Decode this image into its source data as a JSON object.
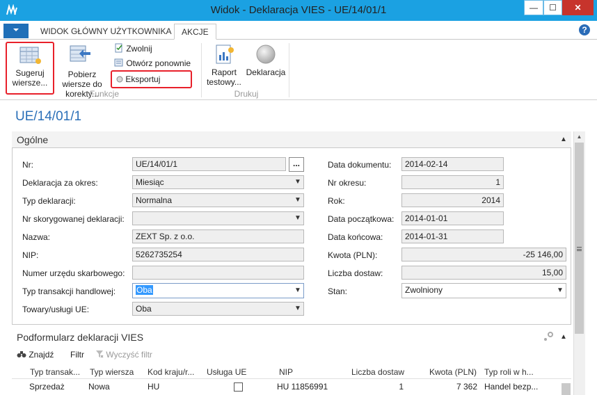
{
  "window": {
    "title": "Widok - Deklaracja VIES - UE/14/01/1",
    "help_label": "?",
    "minimize_label": "—",
    "maximize_label": "☐",
    "close_label": "✕"
  },
  "ribbon": {
    "tabs": [
      {
        "label": "WIDOK GŁÓWNY UŻYTKOWNIKA"
      },
      {
        "label": "AKCJE"
      }
    ],
    "buttons": {
      "suggest_lines": "Sugeruj wiersze...",
      "get_corrections": "Pobierz wiersze do korekty...",
      "release": "Zwolnij",
      "reopen": "Otwórz ponownie",
      "export": "Eksportuj",
      "test_report": "Raport testowy...",
      "declaration": "Deklaracja"
    },
    "groups": {
      "functions": "Funkcje",
      "print": "Drukuj"
    }
  },
  "document": {
    "title": "UE/14/01/1"
  },
  "general": {
    "title": "Ogólne",
    "left_fields": [
      {
        "label": "Nr:",
        "value": "UE/14/01/1"
      },
      {
        "label": "Deklaracja za okres:",
        "value": "Miesiąc"
      },
      {
        "label": "Typ deklaracji:",
        "value": "Normalna"
      },
      {
        "label": "Nr skorygowanej deklaracji:",
        "value": ""
      },
      {
        "label": "Nazwa:",
        "value": "ZEXT Sp. z o.o."
      },
      {
        "label": "NIP:",
        "value": "5262735254"
      },
      {
        "label": "Numer urzędu skarbowego:",
        "value": ""
      },
      {
        "label": "Typ transakcji handlowej:",
        "value": "Oba"
      },
      {
        "label": "Towary/usługi UE:",
        "value": "Oba"
      }
    ],
    "right_fields": [
      {
        "label": "Data dokumentu:",
        "value": "2014-02-14"
      },
      {
        "label": "Nr okresu:",
        "value": "1"
      },
      {
        "label": "Rok:",
        "value": "2014"
      },
      {
        "label": "Data początkowa:",
        "value": "2014-01-01"
      },
      {
        "label": "Data końcowa:",
        "value": "2014-01-31"
      },
      {
        "label": "Kwota (PLN):",
        "value": "-25 146,00"
      },
      {
        "label": "Liczba dostaw:",
        "value": "15,00"
      },
      {
        "label": "Stan:",
        "value": "Zwolniony"
      }
    ],
    "assist_button": "..."
  },
  "subform": {
    "title": "Podformularz deklaracji VIES",
    "toolbar": {
      "find": "Znajdź",
      "filter": "Filtr",
      "clear_filter": "Wyczyść filtr"
    },
    "columns": [
      "Typ transak...",
      "Typ wiersza",
      "Kod kraju/r...",
      "Usługa UE",
      "NIP",
      "Liczba dostaw",
      "Kwota (PLN)",
      "Typ roli w h..."
    ],
    "rows": [
      {
        "trans_type": "Sprzedaż",
        "line_type": "Nowa",
        "country": "HU",
        "eu_service": false,
        "nip": "HU 11856991",
        "deliveries": "1",
        "amount": "7 362",
        "role": "Handel bezp..."
      }
    ]
  },
  "colors": {
    "titlebar": "#1ba1e2",
    "accent": "#2a6fb8",
    "highlight": "#e8202a"
  }
}
